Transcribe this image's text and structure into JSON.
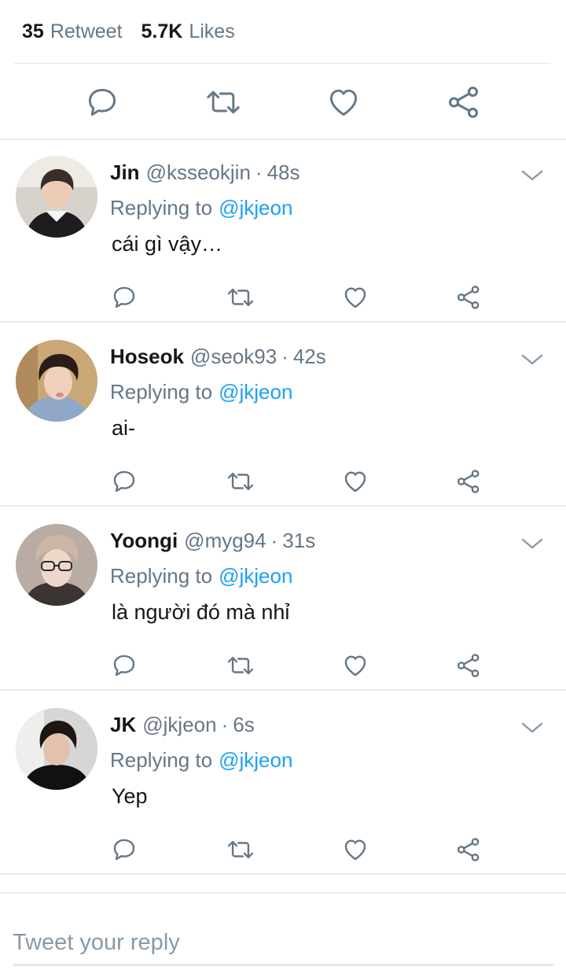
{
  "stats": {
    "retweets_count": "35",
    "retweets_label": "Retweet",
    "likes_count": "5.7K",
    "likes_label": "Likes"
  },
  "main_actions": [
    "reply-icon",
    "retweet-icon",
    "like-icon",
    "share-icon"
  ],
  "replies": [
    {
      "name": "Jin",
      "handle": "@ksseokjin",
      "dot": "·",
      "time": "48s",
      "replying_to": "Replying to",
      "mention": "@jkjeon",
      "text": "cái gì vậy…"
    },
    {
      "name": "Hoseok",
      "handle": "@seok93",
      "dot": "·",
      "time": "42s",
      "replying_to": "Replying to",
      "mention": "@jkjeon",
      "text": "ai-"
    },
    {
      "name": "Yoongi",
      "handle": "@myg94",
      "dot": "·",
      "time": "31s",
      "replying_to": "Replying to",
      "mention": "@jkjeon",
      "text": "là người đó mà nhỉ"
    },
    {
      "name": "JK",
      "handle": "@jkjeon",
      "dot": "·",
      "time": "6s",
      "replying_to": "Replying to",
      "mention": "@jkjeon",
      "text": "Yep"
    }
  ],
  "compose": {
    "placeholder": "Tweet your reply"
  },
  "colors": {
    "accent": "#1da1f2",
    "muted": "#657786",
    "icon": "#657786",
    "divider": "#e6ecf0"
  }
}
